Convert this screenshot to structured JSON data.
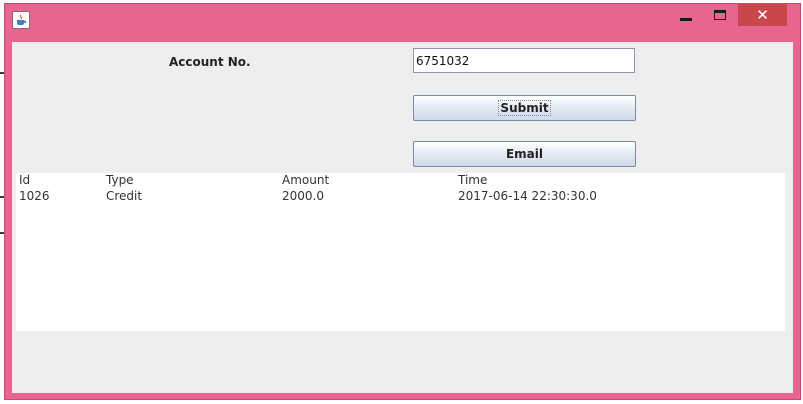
{
  "window": {
    "icon": "java-cup-icon",
    "minimize_label": "",
    "close_glyph": "✕"
  },
  "form": {
    "account_label": "Account No.",
    "account_value": "6751032",
    "submit_label": "Submit",
    "email_label": "Email"
  },
  "table": {
    "columns": [
      "Id",
      "Type",
      "Amount",
      "Time"
    ],
    "rows": [
      [
        "1026",
        "Credit",
        "2000.0",
        "2017-06-14 22:30:30.0"
      ]
    ]
  },
  "colors": {
    "title_bar": "#e8658f",
    "close_button": "#c9474c",
    "client_bg": "#eeeeee"
  }
}
